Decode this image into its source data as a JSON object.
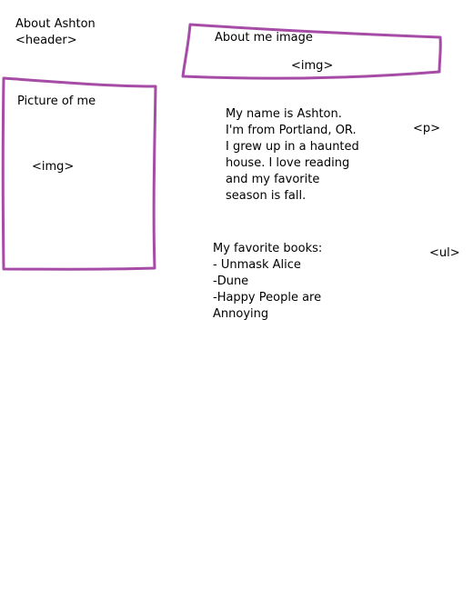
{
  "header": {
    "title": "About Ashton",
    "tag": "<header>"
  },
  "banner": {
    "label": "About me image",
    "tag": "<img>"
  },
  "portrait": {
    "label": "Picture of me",
    "tag": "<img>"
  },
  "bio": {
    "lines": [
      "My name is Ashton.",
      "I'm from Portland, OR.",
      "I grew up in a haunted",
      "house. I love reading",
      "and my favorite",
      "season is fall."
    ],
    "tag": "<p>"
  },
  "books": {
    "heading": "My favorite books:",
    "items": [
      "- Unmask Alice",
      "-Dune",
      "-Happy People are",
      "Annoying"
    ],
    "tag": "<ul>"
  },
  "colors": {
    "sketch_stroke": "#a64ca6"
  }
}
